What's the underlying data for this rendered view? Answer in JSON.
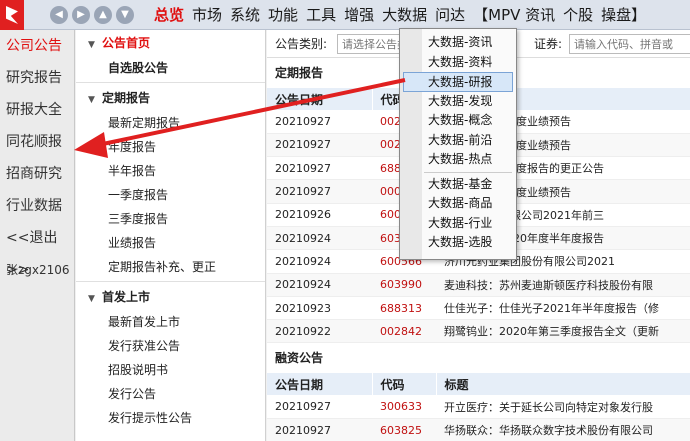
{
  "topbar": {
    "nav_buttons": [
      "◀",
      "▶",
      "▲",
      "▼"
    ],
    "menu": [
      "总览",
      "市场",
      "系统",
      "功能",
      "工具",
      "增强",
      "大数据",
      "问达",
      "【MPV 资讯",
      "个股",
      "操盘】"
    ]
  },
  "left_tabs": [
    "公司公告",
    "研究报告",
    "研报大全",
    "同花顺报",
    "招商研究",
    "行业数据",
    "<<退出>>",
    "张zgx2106"
  ],
  "nav2": {
    "home": "公告首页",
    "watch": "自选股公告",
    "periodic_header": "定期报告",
    "periodic_items": [
      "最新定期报告",
      "年度报告",
      "半年报告",
      "一季度报告",
      "三季度报告",
      "业绩报告",
      "定期报告补充、更正"
    ],
    "ipo_header": "首发上市",
    "ipo_items": [
      "最新首发上市",
      "发行获准公告",
      "招股说明书",
      "发行公告",
      "发行提示性公告"
    ]
  },
  "filter": {
    "category_label": "公告类别:",
    "category_placeholder": "请选择公告类别",
    "stock_label": "证券:",
    "stock_placeholder": "请输入代码、拼音或"
  },
  "periodic": {
    "title": "定期报告",
    "headers": [
      "公告日期",
      "代码",
      "标题"
    ],
    "rows": [
      [
        "20210927",
        "002",
        "2021年前三季度业绩预告"
      ],
      [
        "20210927",
        "002",
        "2021年前三季度业绩预告"
      ],
      [
        "20210927",
        "688",
        "于2021年半年度报告的更正公告"
      ],
      [
        "20210927",
        "000",
        "2021年前三季度业绩预告"
      ],
      [
        "20210926",
        "600",
        "汇能源股份有限公司2021年前三"
      ],
      [
        "20210924",
        "603",
        "味食品关于2020年度半年度报告"
      ],
      [
        "20210924",
        "600566",
        "济川元药业集团股份有限公司2021"
      ],
      [
        "20210924",
        "603990",
        "麦迪科技：苏州麦迪斯顿医疗科技股份有限"
      ],
      [
        "20210923",
        "688313",
        "仕佳光子：仕佳光子2021年半年度报告（修"
      ],
      [
        "20210922",
        "002842",
        "翔鹭钨业：2020年第三季度报告全文（更新"
      ]
    ]
  },
  "financing": {
    "title": "融资公告",
    "headers": [
      "公告日期",
      "代码",
      "标题"
    ],
    "rows": [
      [
        "20210927",
        "300633",
        "开立医疗：关于延长公司向特定对象发行股"
      ],
      [
        "20210927",
        "603825",
        "华扬联众：华扬联众数字技术股份有限公司"
      ]
    ]
  },
  "dropdown": {
    "group1": [
      "大数据-资讯",
      "大数据-资料",
      "大数据-研报",
      "大数据-发现",
      "大数据-概念",
      "大数据-前沿",
      "大数据-热点"
    ],
    "group2": [
      "大数据-基金",
      "大数据-商品",
      "大数据-行业",
      "大数据-选股"
    ],
    "highlighted": "大数据-研报"
  },
  "colors": {
    "accent": "#e01010",
    "arrow": "#e02020",
    "highlight": "#d7e7f8"
  }
}
